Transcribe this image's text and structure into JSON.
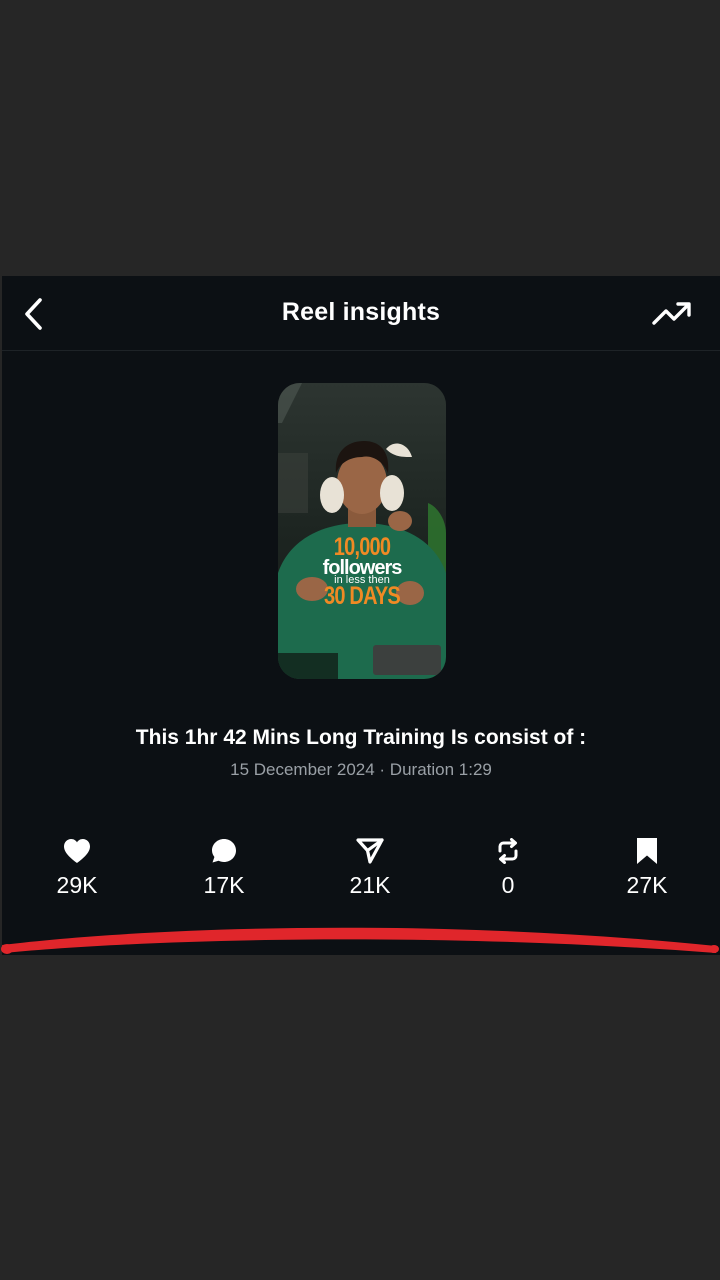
{
  "header": {
    "title": "Reel insights",
    "back_icon": "chevron-left-icon",
    "trend_icon": "trending-up-icon"
  },
  "reel": {
    "thumbnail_text": {
      "line1": "10,000",
      "line2": "followers",
      "line3": "in less then",
      "line4": "30 DAYS"
    },
    "caption": "This 1hr 42 Mins Long Training Is consist of :",
    "meta": "15 December 2024 · Duration 1:29"
  },
  "stats": [
    {
      "icon": "heart-icon",
      "value": "29K"
    },
    {
      "icon": "comment-icon",
      "value": "17K"
    },
    {
      "icon": "share-icon",
      "value": "21K"
    },
    {
      "icon": "repost-icon",
      "value": "0"
    },
    {
      "icon": "bookmark-icon",
      "value": "27K"
    }
  ],
  "colors": {
    "background": "#262626",
    "screen": "#0c1014",
    "text": "#ffffff",
    "muted": "#9aa0a6",
    "annotation": "#e0262b",
    "overlay_accent": "#f08a24"
  }
}
